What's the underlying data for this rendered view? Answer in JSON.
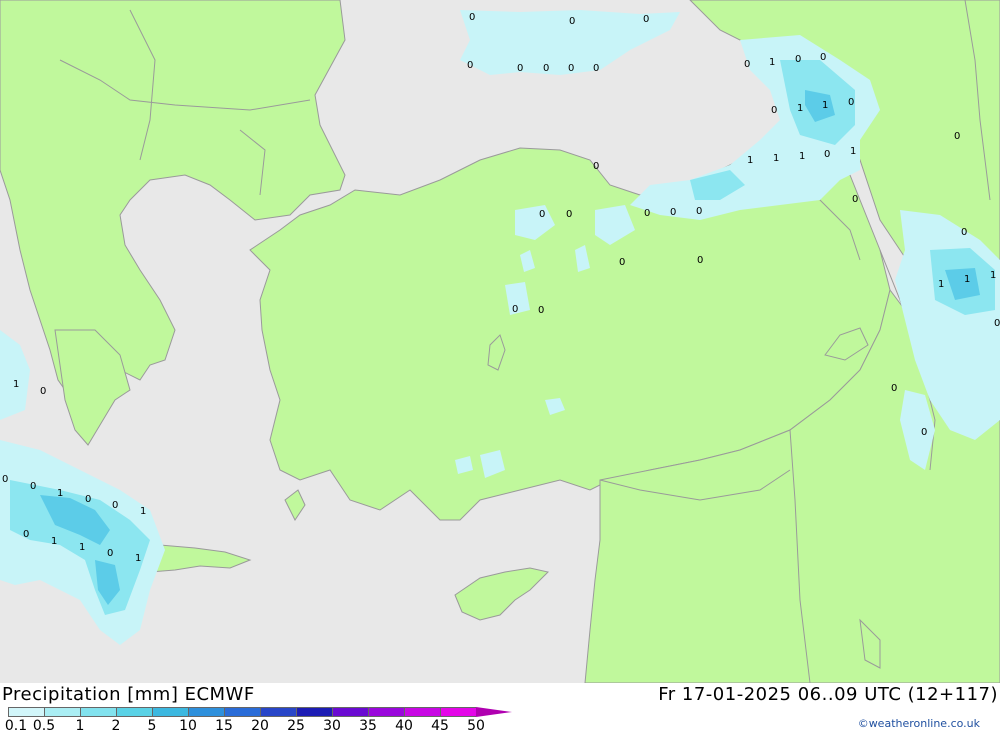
{
  "title": {
    "left": "Precipitation [mm] ECMWF",
    "right": "Fr 17-01-2025 06..09 UTC (12+117)"
  },
  "credit": "©weatheronline.co.uk",
  "colors": {
    "sea": "#e8e8e8",
    "land": "#c0f89c",
    "border": "#9a9a9a",
    "precip_light": "#c8f4f8",
    "precip_mid": "#8ce6f0",
    "precip_heavy": "#5ccce8"
  },
  "legend": {
    "ticks": [
      "0.1",
      "0.5",
      "1",
      "2",
      "5",
      "10",
      "15",
      "20",
      "25",
      "30",
      "35",
      "40",
      "45",
      "50"
    ],
    "colors": [
      "#d2f6fa",
      "#aaeef4",
      "#82e2ee",
      "#5ad2e6",
      "#3cb8e0",
      "#2e90dc",
      "#2a6cd8",
      "#2846c8",
      "#1c1cb4",
      "#6a0ad2",
      "#9a08dc",
      "#c808e4",
      "#e406e8",
      "#b000b0"
    ]
  },
  "point_values": [
    "0",
    "0",
    "0",
    "0",
    "0",
    "0",
    "0",
    "0",
    "0",
    "1",
    "0",
    "0",
    "0",
    "1",
    "1",
    "0",
    "0",
    "1",
    "1",
    "1",
    "0",
    "1",
    "0",
    "0",
    "0",
    "0",
    "0",
    "0",
    "0",
    "0",
    "0",
    "0",
    "0",
    "0",
    "1",
    "1",
    "1",
    "0",
    "0",
    "0",
    "0",
    "1",
    "0",
    "0",
    "1",
    "0",
    "0",
    "1",
    "1",
    "0",
    "1",
    "0",
    "1"
  ]
}
